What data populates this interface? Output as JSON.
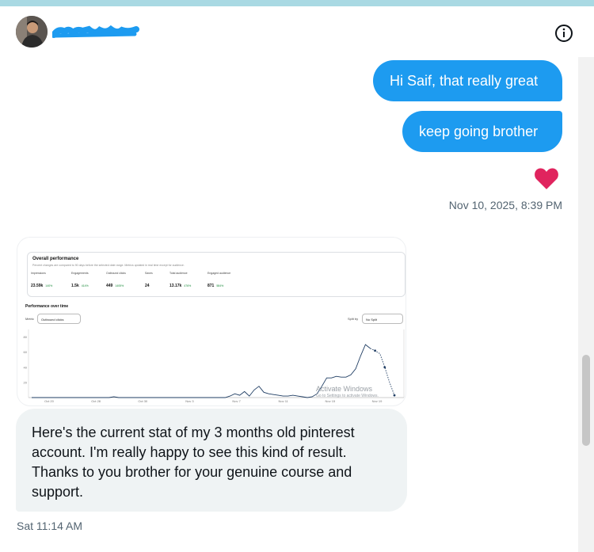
{
  "header": {
    "avatar_icon": "person-avatar",
    "name_redaction_color": "#1d9bf0",
    "info_icon": "info-circle-icon"
  },
  "messages": {
    "out1": "Hi Saif, that really great",
    "out2": "keep going brother",
    "reaction_icon": "red-heart",
    "out_timestamp": "Nov 10, 2025, 8:39 PM",
    "in_text": "Here's the current stat of my 3 months old pinterest account. I'm really happy to see this kind of result. Thanks to you brother for your genuine course and support.",
    "in_timestamp": "Sat 11:14 AM"
  },
  "screenshot": {
    "overall_title": "Overall performance",
    "overall_desc": "Percent changes are compared to 90 days before the selected date range. Metrics updated in real time except for audience.",
    "metrics": [
      {
        "label": "Impressions",
        "value": "23.59k",
        "change": "140%"
      },
      {
        "label": "Engagements",
        "value": "1.5k",
        "change": "414%"
      },
      {
        "label": "Outbound clicks",
        "value": "449",
        "change": "1405%"
      },
      {
        "label": "Saves",
        "value": "24",
        "change": ""
      },
      {
        "label": "Total audience",
        "value": "13.17k",
        "change": "476%"
      },
      {
        "label": "Engaged audience",
        "value": "871",
        "change": "584%"
      }
    ],
    "pot_title": "Performance over time",
    "metric_label": "Metric",
    "metric_value": "Outbound clicks",
    "split_label": "Split by",
    "split_value": "No Split",
    "activate_title": "Activate Windows",
    "activate_sub": "Go to Settings to activate Windows."
  },
  "chart_data": {
    "type": "line",
    "x_ticks": [
      "Oct 20",
      "Oct 28",
      "Oct 30",
      "Nov 3",
      "Nov 7",
      "Nov 11",
      "Nov 15",
      "Nov 19"
    ],
    "y_ticks": [
      "80",
      "60",
      "40",
      "20"
    ],
    "ylim": [
      0,
      90
    ],
    "series": [
      {
        "values": [
          0,
          0,
          0,
          0,
          0,
          0,
          0,
          0,
          0,
          0,
          0,
          0,
          0,
          0,
          0,
          0,
          0,
          1,
          0,
          0,
          0,
          0,
          0,
          0,
          0,
          0,
          0,
          0,
          0,
          0,
          0,
          0,
          0,
          0,
          0,
          0,
          0,
          0,
          0,
          0,
          0,
          2,
          5,
          3,
          8,
          2,
          10,
          15,
          7,
          5,
          4,
          3,
          2,
          2,
          3,
          2,
          1,
          0,
          1,
          5,
          15,
          26,
          26,
          28,
          27,
          27,
          30,
          38,
          55,
          70,
          65,
          62,
          58,
          40,
          20,
          3
        ],
        "projected_from_index": 70
      }
    ]
  }
}
